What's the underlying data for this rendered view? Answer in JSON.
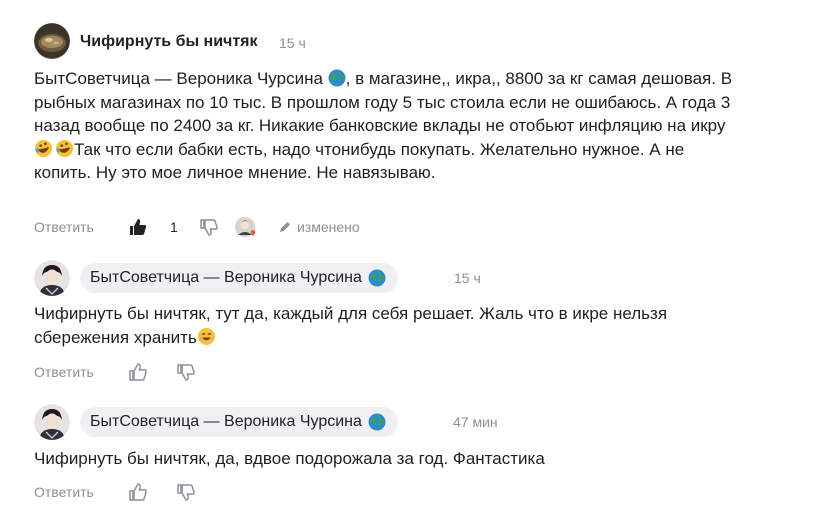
{
  "comments": [
    {
      "author": "Чифирнуть бы ничтяк",
      "time": "15 ч",
      "text_parts": [
        "БытСоветчица — Вероника Чурсина ",
        ", в магазине,, икра,, 8800 за кг самая дешовая. В рыбных магазинах по 10 тыс. В прошлом году 5 тыс стоила если не ошибаюсь. А года 3 назад вообще по 2400 за кг. Никакие банковские вклады не отобьют инфляцию на икру",
        "Так что если бабки есть, надо чтонибудь покупать. Желательно нужное. А не копить. Ну это мое личное мнение. Не навязываю."
      ],
      "reply_label": "Ответить",
      "likes": "1",
      "edited_label": "изменено"
    },
    {
      "author": "БытСоветчица — Вероника Чурсина",
      "time": "15 ч",
      "text": "Чифирнуть бы ничтяк, тут да, каждый для себя решает. Жаль что в икре нельзя сбережения хранить",
      "reply_label": "Ответить"
    },
    {
      "author": "БытСоветчица — Вероника Чурсина",
      "time": "47 мин",
      "text": "Чифирнуть бы ничтяк, да, вдвое подорожала за год. Фантастика",
      "reply_label": "Ответить"
    }
  ],
  "icons": [
    "globe-icon",
    "thumbs-up-icon",
    "thumbs-down-icon",
    "rofl-emoji",
    "smiling-emoji",
    "pencil-icon"
  ],
  "colors": {
    "muted": "#8a8f98",
    "chip": "#eef0f3",
    "text": "#1f1f1f"
  }
}
